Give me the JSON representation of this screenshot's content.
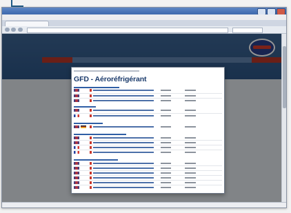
{
  "screen": {
    "width": 422,
    "height": 309
  },
  "modal": {
    "title": "GFD - Aéroréfrigérant"
  },
  "colors": {
    "page_header": "#2c5484",
    "modal_title": "#1a3a6b",
    "accent_red": "#b73628"
  }
}
